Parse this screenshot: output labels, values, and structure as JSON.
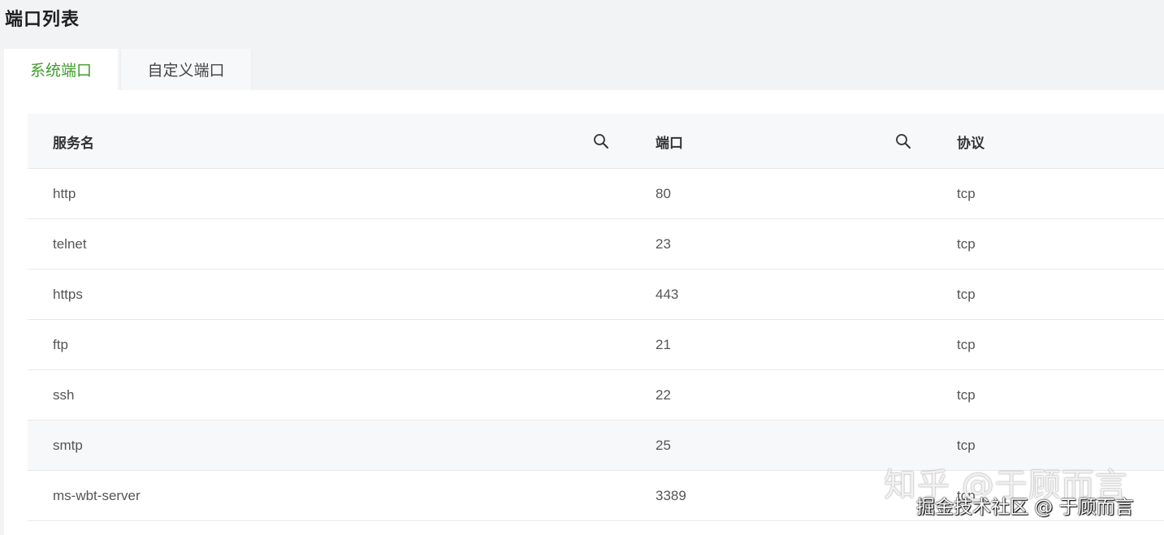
{
  "page": {
    "title": "端口列表"
  },
  "tabs": [
    {
      "label": "系统端口",
      "active": true
    },
    {
      "label": "自定义端口",
      "active": false
    }
  ],
  "table": {
    "columns": [
      {
        "label": "服务名",
        "searchable": true,
        "icon": "search-icon"
      },
      {
        "label": "端口",
        "searchable": true,
        "icon": "search-icon"
      },
      {
        "label": "协议",
        "searchable": false
      }
    ],
    "rows": [
      {
        "service": "http",
        "port": "80",
        "protocol": "tcp"
      },
      {
        "service": "telnet",
        "port": "23",
        "protocol": "tcp"
      },
      {
        "service": "https",
        "port": "443",
        "protocol": "tcp"
      },
      {
        "service": "ftp",
        "port": "21",
        "protocol": "tcp"
      },
      {
        "service": "ssh",
        "port": "22",
        "protocol": "tcp"
      },
      {
        "service": "smtp",
        "port": "25",
        "protocol": "tcp"
      },
      {
        "service": "ms-wbt-server",
        "port": "3389",
        "protocol": "tcp"
      }
    ]
  },
  "watermark": {
    "zhihu": "知乎 @于顾而言",
    "juejin": "掘金技术社区 @ 于顾而言"
  },
  "colors": {
    "accent": "#3e9b2a",
    "background": "#f2f3f5",
    "header_bg": "#f7f8fa"
  }
}
